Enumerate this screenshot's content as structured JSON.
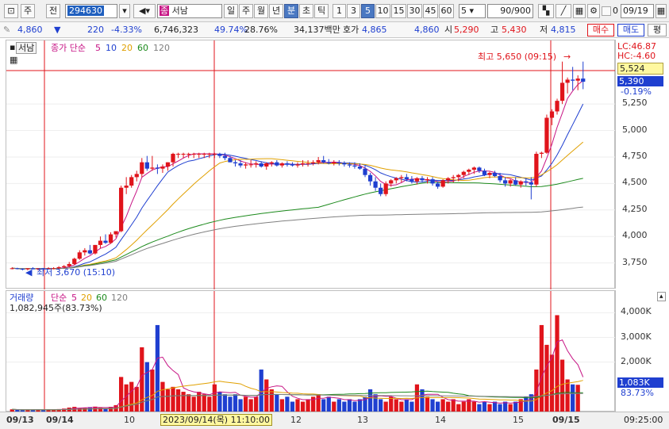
{
  "toolbar": {
    "btn_1": "주",
    "btn_2": "전",
    "code": "294630",
    "stock_tag": "종",
    "stock_name": "서남",
    "periods": [
      "일",
      "주",
      "월",
      "년",
      "분",
      "초",
      "틱"
    ],
    "period_selected": "분",
    "minutes": [
      "1",
      "3",
      "5",
      "10",
      "15",
      "30",
      "45",
      "60"
    ],
    "minute_selected": "5",
    "interval_value": "5",
    "count_value": "90",
    "count_max": "/900",
    "date_prefix": "0",
    "date_value": "09/19"
  },
  "quote": {
    "price": "4,860",
    "arrow": "▼",
    "change": "220",
    "change_pct": "-4.33%",
    "volume": "6,746,323",
    "turnover_pct": "49.74%",
    "other_pct": "28.76%",
    "trade_value": "34,137백만",
    "hoga_label": "호가",
    "ask": "4,865",
    "bid": "4,860",
    "open_label": "시",
    "open": "5,290",
    "high_label": "고",
    "high": "5,430",
    "low_label": "저",
    "low": "4,815",
    "buy_label": "매수",
    "sell_label": "매도",
    "eval_label": "평"
  },
  "price_panel": {
    "name_tab": "서남",
    "legend_label": "종가 단순",
    "ma_periods": [
      "5",
      "10",
      "20",
      "60",
      "120"
    ],
    "ma_colors": [
      "#c71585",
      "#1f3fd0",
      "#e0a000",
      "#1c8a1c",
      "#808080"
    ],
    "high_note": "최고 5,650 (09:15)",
    "low_note": "최저 3,670 (15:10)",
    "lc": "LC:46.87",
    "hc": "HC:-4.60",
    "cur_price_tag": "5,524",
    "cur_tag2": "5,390",
    "cur_tag2_pct": "-0.19%",
    "y_ticks": [
      "5,250",
      "5,000",
      "4,750",
      "4,500",
      "4,250",
      "4,000",
      "3,750"
    ]
  },
  "vol_panel": {
    "legend_label": "거래량",
    "legend_ma": "단순",
    "ma_periods": [
      "5",
      "20",
      "60",
      "120"
    ],
    "ma_colors": [
      "#c71585",
      "#e0a000",
      "#1c8a1c",
      "#808080"
    ],
    "current": "1,082,945주(83.73%)",
    "y_ticks": [
      "4,000K",
      "3,000K",
      "2,000K"
    ],
    "cur_tag": "1,083K",
    "cur_tag_pct": "83.73%"
  },
  "x_axis": {
    "labels": [
      "09/13",
      "09/14",
      "10",
      "12",
      "13",
      "14",
      "15",
      "09/15"
    ],
    "cursor_label": "2023/09/14(목) 11:10:00",
    "time_label": "09:25:00"
  },
  "colors": {
    "up": "#e0141b",
    "down": "#1f3fd0",
    "accent": "#4a78c2"
  },
  "chart_data": {
    "type": "candlestick",
    "y_ticks": [
      5250,
      5000,
      4750,
      4500,
      4250,
      4000,
      3750
    ],
    "ylim": [
      3620,
      5700
    ],
    "candles": [
      [
        3700,
        3710,
        3690,
        3700
      ],
      [
        3700,
        3705,
        3690,
        3695
      ],
      [
        3695,
        3700,
        3680,
        3690
      ],
      [
        3690,
        3700,
        3680,
        3700
      ],
      [
        3700,
        3710,
        3690,
        3690
      ],
      [
        3690,
        3700,
        3680,
        3700
      ],
      [
        3700,
        3700,
        3670,
        3690
      ],
      [
        3690,
        3710,
        3690,
        3700
      ],
      [
        3700,
        3710,
        3690,
        3700
      ],
      [
        3700,
        3720,
        3690,
        3710
      ],
      [
        3710,
        3730,
        3700,
        3720
      ],
      [
        3720,
        3760,
        3710,
        3740
      ],
      [
        3740,
        3800,
        3730,
        3790
      ],
      [
        3790,
        3870,
        3780,
        3850
      ],
      [
        3850,
        3890,
        3820,
        3870
      ],
      [
        3870,
        3920,
        3830,
        3840
      ],
      [
        3840,
        3920,
        3830,
        3920
      ],
      [
        3920,
        4000,
        3890,
        3960
      ],
      [
        3960,
        4020,
        3930,
        3940
      ],
      [
        3940,
        4040,
        3930,
        4020
      ],
      [
        4020,
        4050,
        3990,
        4050
      ],
      [
        4050,
        4480,
        4040,
        4460
      ],
      [
        4460,
        4560,
        4400,
        4480
      ],
      [
        4480,
        4580,
        4460,
        4560
      ],
      [
        4560,
        4620,
        4520,
        4590
      ],
      [
        4590,
        4740,
        4560,
        4700
      ],
      [
        4700,
        4760,
        4620,
        4640
      ],
      [
        4640,
        4760,
        4620,
        4650
      ],
      [
        4650,
        4680,
        4590,
        4640
      ],
      [
        4640,
        4680,
        4600,
        4660
      ],
      [
        4660,
        4700,
        4620,
        4700
      ],
      [
        4700,
        4790,
        4660,
        4780
      ],
      [
        4780,
        4790,
        4740,
        4780
      ],
      [
        4780,
        4790,
        4740,
        4780
      ],
      [
        4780,
        4790,
        4740,
        4780
      ],
      [
        4780,
        4790,
        4740,
        4780
      ],
      [
        4780,
        4790,
        4740,
        4780
      ],
      [
        4780,
        4790,
        4740,
        4780
      ],
      [
        4780,
        4790,
        4740,
        4780
      ],
      [
        4780,
        4790,
        4740,
        4780
      ],
      [
        4780,
        4790,
        4740,
        4760
      ],
      [
        4760,
        4790,
        4720,
        4740
      ],
      [
        4740,
        4760,
        4700,
        4700
      ],
      [
        4700,
        4720,
        4660,
        4690
      ],
      [
        4690,
        4720,
        4650,
        4670
      ],
      [
        4670,
        4700,
        4640,
        4680
      ],
      [
        4680,
        4720,
        4650,
        4680
      ],
      [
        4680,
        4710,
        4650,
        4690
      ],
      [
        4690,
        4710,
        4650,
        4660
      ],
      [
        4660,
        4700,
        4630,
        4690
      ],
      [
        4690,
        4710,
        4660,
        4700
      ],
      [
        4700,
        4720,
        4660,
        4670
      ],
      [
        4670,
        4700,
        4650,
        4690
      ],
      [
        4690,
        4710,
        4660,
        4680
      ],
      [
        4680,
        4700,
        4660,
        4670
      ],
      [
        4670,
        4700,
        4650,
        4680
      ],
      [
        4680,
        4720,
        4660,
        4690
      ],
      [
        4690,
        4720,
        4660,
        4690
      ],
      [
        4690,
        4720,
        4670,
        4700
      ],
      [
        4700,
        4750,
        4680,
        4720
      ],
      [
        4720,
        4760,
        4690,
        4700
      ],
      [
        4700,
        4730,
        4680,
        4690
      ],
      [
        4690,
        4720,
        4670,
        4700
      ],
      [
        4700,
        4720,
        4670,
        4690
      ],
      [
        4690,
        4710,
        4660,
        4680
      ],
      [
        4680,
        4700,
        4650,
        4670
      ],
      [
        4670,
        4700,
        4640,
        4660
      ],
      [
        4660,
        4690,
        4630,
        4640
      ],
      [
        4640,
        4670,
        4560,
        4580
      ],
      [
        4580,
        4600,
        4480,
        4520
      ],
      [
        4520,
        4560,
        4430,
        4460
      ],
      [
        4460,
        4500,
        4380,
        4400
      ],
      [
        4400,
        4520,
        4380,
        4500
      ],
      [
        4500,
        4540,
        4470,
        4530
      ],
      [
        4530,
        4560,
        4500,
        4550
      ],
      [
        4550,
        4580,
        4510,
        4560
      ],
      [
        4560,
        4590,
        4520,
        4540
      ],
      [
        4540,
        4570,
        4500,
        4520
      ],
      [
        4520,
        4560,
        4490,
        4550
      ],
      [
        4550,
        4570,
        4510,
        4530
      ],
      [
        4530,
        4560,
        4500,
        4540
      ],
      [
        4540,
        4560,
        4480,
        4500
      ],
      [
        4500,
        4520,
        4450,
        4470
      ],
      [
        4470,
        4540,
        4460,
        4530
      ],
      [
        4530,
        4560,
        4500,
        4550
      ],
      [
        4550,
        4580,
        4510,
        4560
      ],
      [
        4560,
        4590,
        4520,
        4580
      ],
      [
        4580,
        4620,
        4550,
        4610
      ],
      [
        4610,
        4640,
        4580,
        4630
      ],
      [
        4630,
        4660,
        4590,
        4650
      ],
      [
        4650,
        4660,
        4600,
        4620
      ],
      [
        4620,
        4640,
        4570,
        4580
      ],
      [
        4580,
        4610,
        4550,
        4600
      ],
      [
        4600,
        4620,
        4560,
        4570
      ],
      [
        4570,
        4600,
        4510,
        4530
      ],
      [
        4530,
        4560,
        4470,
        4500
      ],
      [
        4500,
        4540,
        4470,
        4530
      ],
      [
        4530,
        4560,
        4480,
        4490
      ],
      [
        4490,
        4530,
        4460,
        4520
      ],
      [
        4520,
        4550,
        4480,
        4510
      ],
      [
        4510,
        4560,
        4350,
        4490
      ],
      [
        4490,
        4800,
        4470,
        4780
      ],
      [
        4780,
        4800,
        4740,
        4790
      ],
      [
        4790,
        5150,
        4780,
        5120
      ],
      [
        5120,
        5200,
        5050,
        5180
      ],
      [
        5180,
        5300,
        5150,
        5280
      ],
      [
        5280,
        5650,
        5250,
        5450
      ],
      [
        5450,
        5500,
        5350,
        5480
      ],
      [
        5480,
        5600,
        5380,
        5470
      ],
      [
        5470,
        5520,
        5380,
        5490
      ],
      [
        5490,
        5650,
        5390,
        5460
      ]
    ],
    "volumes_k": [
      90,
      70,
      60,
      80,
      70,
      90,
      60,
      80,
      70,
      100,
      120,
      160,
      190,
      130,
      150,
      180,
      200,
      160,
      120,
      190,
      260,
      1400,
      1100,
      1200,
      1000,
      2600,
      2000,
      1700,
      3500,
      1200,
      900,
      1000,
      900,
      800,
      700,
      600,
      800,
      700,
      600,
      1100,
      800,
      700,
      600,
      700,
      500,
      600,
      500,
      600,
      1700,
      1300,
      900,
      700,
      500,
      600,
      400,
      500,
      400,
      500,
      600,
      700,
      500,
      600,
      400,
      500,
      400,
      500,
      400,
      500,
      600,
      900,
      700,
      500,
      400,
      600,
      500,
      400,
      500,
      400,
      1100,
      900,
      600,
      500,
      400,
      500,
      400,
      500,
      300,
      400,
      500,
      400,
      300,
      400,
      300,
      400,
      300,
      400,
      300,
      400,
      500,
      600,
      700,
      1700,
      3500,
      2700,
      2300,
      3900,
      2100,
      1300,
      1100,
      1083
    ]
  }
}
